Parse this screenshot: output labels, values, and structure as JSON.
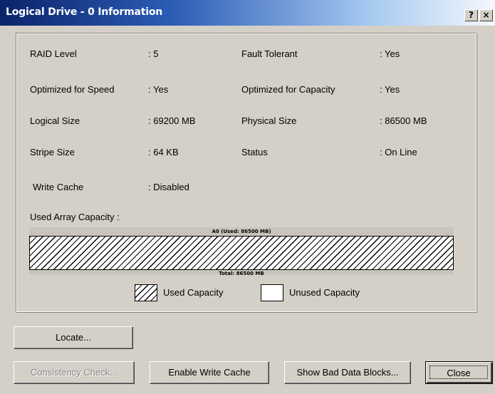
{
  "window": {
    "title": "Logical Drive - 0 Information",
    "help_glyph": "?",
    "close_glyph": "×"
  },
  "info": {
    "raid_level": {
      "label": "RAID Level",
      "value": ": 5"
    },
    "fault_tolerant": {
      "label": "Fault Tolerant",
      "value": ": Yes"
    },
    "optimized_speed": {
      "label": "Optimized for Speed",
      "value": ": Yes"
    },
    "optimized_capacity": {
      "label": "Optimized for Capacity",
      "value": ": Yes"
    },
    "logical_size": {
      "label": "Logical Size",
      "value": ": 69200 MB"
    },
    "physical_size": {
      "label": "Physical Size",
      "value": ": 86500 MB"
    },
    "stripe_size": {
      "label": "Stripe Size",
      "value": ": 64 KB"
    },
    "status": {
      "label": "Status",
      "value": ": On Line"
    },
    "write_cache": {
      "label": "Write Cache",
      "value": ": Disabled"
    }
  },
  "capacity": {
    "heading": "Used Array Capacity :",
    "used_label": "A0 (Used: 86500 MB)",
    "total_label": "Total: 86500 MB",
    "used_fraction": 1.0
  },
  "legend": {
    "used": "Used Capacity",
    "unused": "Unused Capacity"
  },
  "buttons": {
    "locate": "Locate...",
    "consistency_check": "Consistency Check...",
    "enable_write_cache": "Enable Write Cache",
    "show_bad_blocks": "Show Bad Data Blocks...",
    "close": "Close"
  }
}
